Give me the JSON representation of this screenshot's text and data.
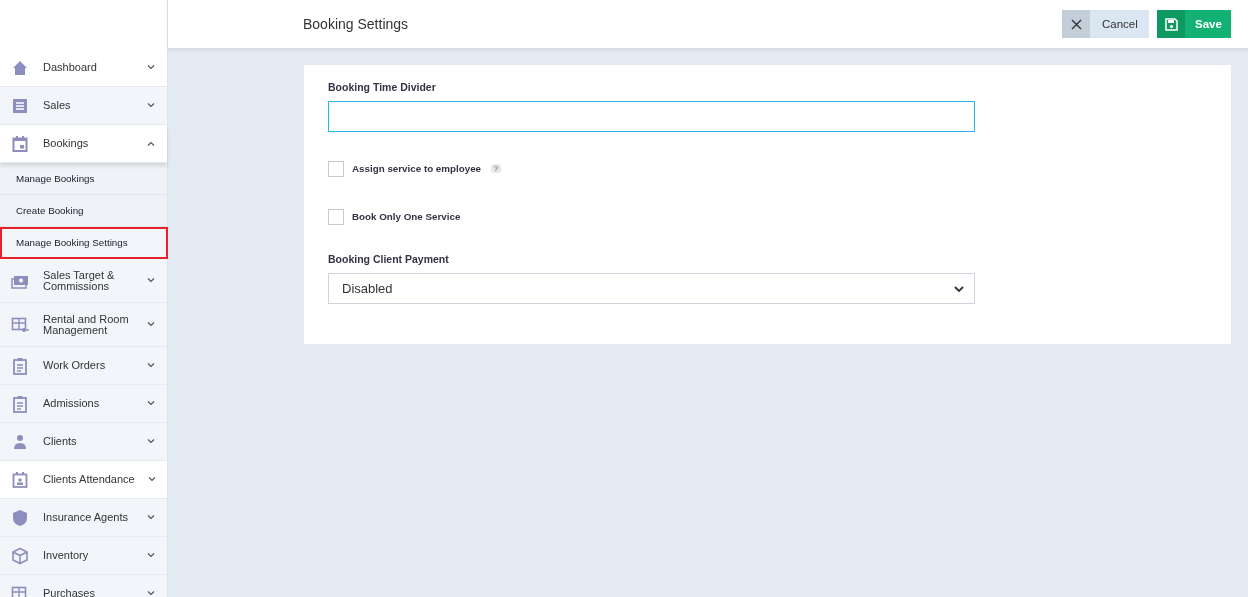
{
  "sidebar": {
    "items": [
      {
        "label": "Dashboard",
        "expanded": false,
        "highlighted": true
      },
      {
        "label": "Sales",
        "expanded": false,
        "highlighted": false
      },
      {
        "label": "Bookings",
        "expanded": true,
        "highlighted": true,
        "children": [
          {
            "label": "Manage Bookings",
            "selected": false
          },
          {
            "label": "Create Booking",
            "selected": false
          },
          {
            "label": "Manage Booking Settings",
            "selected": true
          }
        ]
      },
      {
        "label": "Sales Target & Commissions",
        "expanded": false,
        "highlighted": false
      },
      {
        "label": "Rental and Room Management",
        "expanded": false,
        "highlighted": false
      },
      {
        "label": "Work Orders",
        "expanded": false,
        "highlighted": false
      },
      {
        "label": "Admissions",
        "expanded": false,
        "highlighted": false
      },
      {
        "label": "Clients",
        "expanded": false,
        "highlighted": false
      },
      {
        "label": "Clients Attendance",
        "expanded": false,
        "highlighted": true
      },
      {
        "label": "Insurance Agents",
        "expanded": false,
        "highlighted": false
      },
      {
        "label": "Inventory",
        "expanded": false,
        "highlighted": false
      },
      {
        "label": "Purchases",
        "expanded": false,
        "highlighted": false
      }
    ]
  },
  "header": {
    "title": "Booking Settings",
    "buttons": [
      {
        "kind": "cancel",
        "label": "Cancel"
      },
      {
        "kind": "save",
        "label": "Save"
      }
    ]
  },
  "form": {
    "fields": [
      {
        "kind": "text",
        "label": "Booking Time Divider",
        "focused": true
      },
      {
        "kind": "checkbox",
        "label": "Assign service to employee",
        "checked": false,
        "help": "?"
      },
      {
        "kind": "checkbox",
        "label": "Book Only One Service",
        "checked": false
      },
      {
        "kind": "select",
        "label": "Booking Client Payment",
        "value": "Disabled"
      }
    ]
  }
}
